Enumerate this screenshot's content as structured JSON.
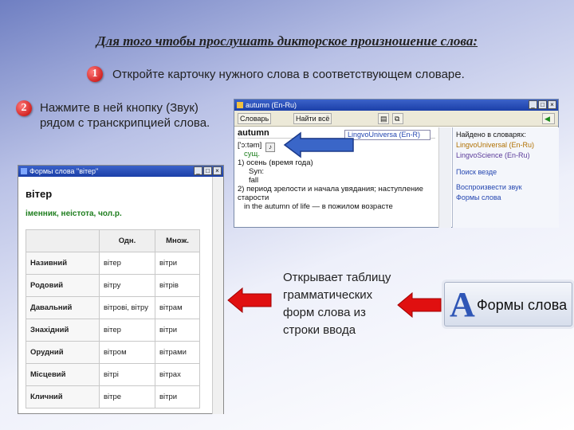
{
  "title": "Для того чтобы прослушать дикторское произношение слова:",
  "steps": [
    {
      "num": "1",
      "text": "Откройте карточку нужного слова в соответствующем словаре."
    },
    {
      "num": "2",
      "text": "Нажмите в ней кнопку (Звук) рядом с транскрипцией слова."
    }
  ],
  "lingvo_window": {
    "title": "autumn (En-Ru)",
    "toolbar": {
      "dict_btn": "Словарь",
      "add_btn": "Найти всё",
      "dict_field": "LingvoUniversa (En-R)"
    },
    "word": "autumn",
    "transcription": "['ɔ:təm]",
    "sound_icon": "speaker-icon",
    "lines": [
      "сущ.",
      "1) осень (время года)",
      "Syn:",
      "fall",
      "2) период зрелости и начала увядания; наступление старости",
      "in the autumn of life — в пожилом возрасте"
    ],
    "sidebar": {
      "heading": "Найдено в словарях:",
      "dicts": [
        "LingvoUniversal (En-Ru)",
        "LingvoScience (En-Ru)"
      ],
      "links": [
        "Поиск везде",
        "Воспроизвести звук",
        "Формы слова"
      ]
    }
  },
  "forms_window": {
    "title": "Формы слова \"вітер\"",
    "word": "вітер",
    "pos": "іменник, неістота, чол.р.",
    "headers": [
      "",
      "Одн.",
      "Множ."
    ],
    "rows": [
      [
        "Називний",
        "вітер",
        "вітри"
      ],
      [
        "Родовий",
        "вітру",
        "вітрів"
      ],
      [
        "Давальний",
        "вітрові, вітру",
        "вітрам"
      ],
      [
        "Знахідний",
        "вітер",
        "вітри"
      ],
      [
        "Орудний",
        "вітром",
        "вітрами"
      ],
      [
        "Місцевий",
        "вітрі",
        "вітрах"
      ],
      [
        "Кличний",
        "вітре",
        "вітри"
      ]
    ]
  },
  "description": "Открывает таблицу грамматических форм слова из строки ввода",
  "button": {
    "label": "Формы слова",
    "icon": "letter-a-icon"
  },
  "colors": {
    "arrow_red": "#e01010",
    "arrow_blue": "#3a66c8"
  }
}
